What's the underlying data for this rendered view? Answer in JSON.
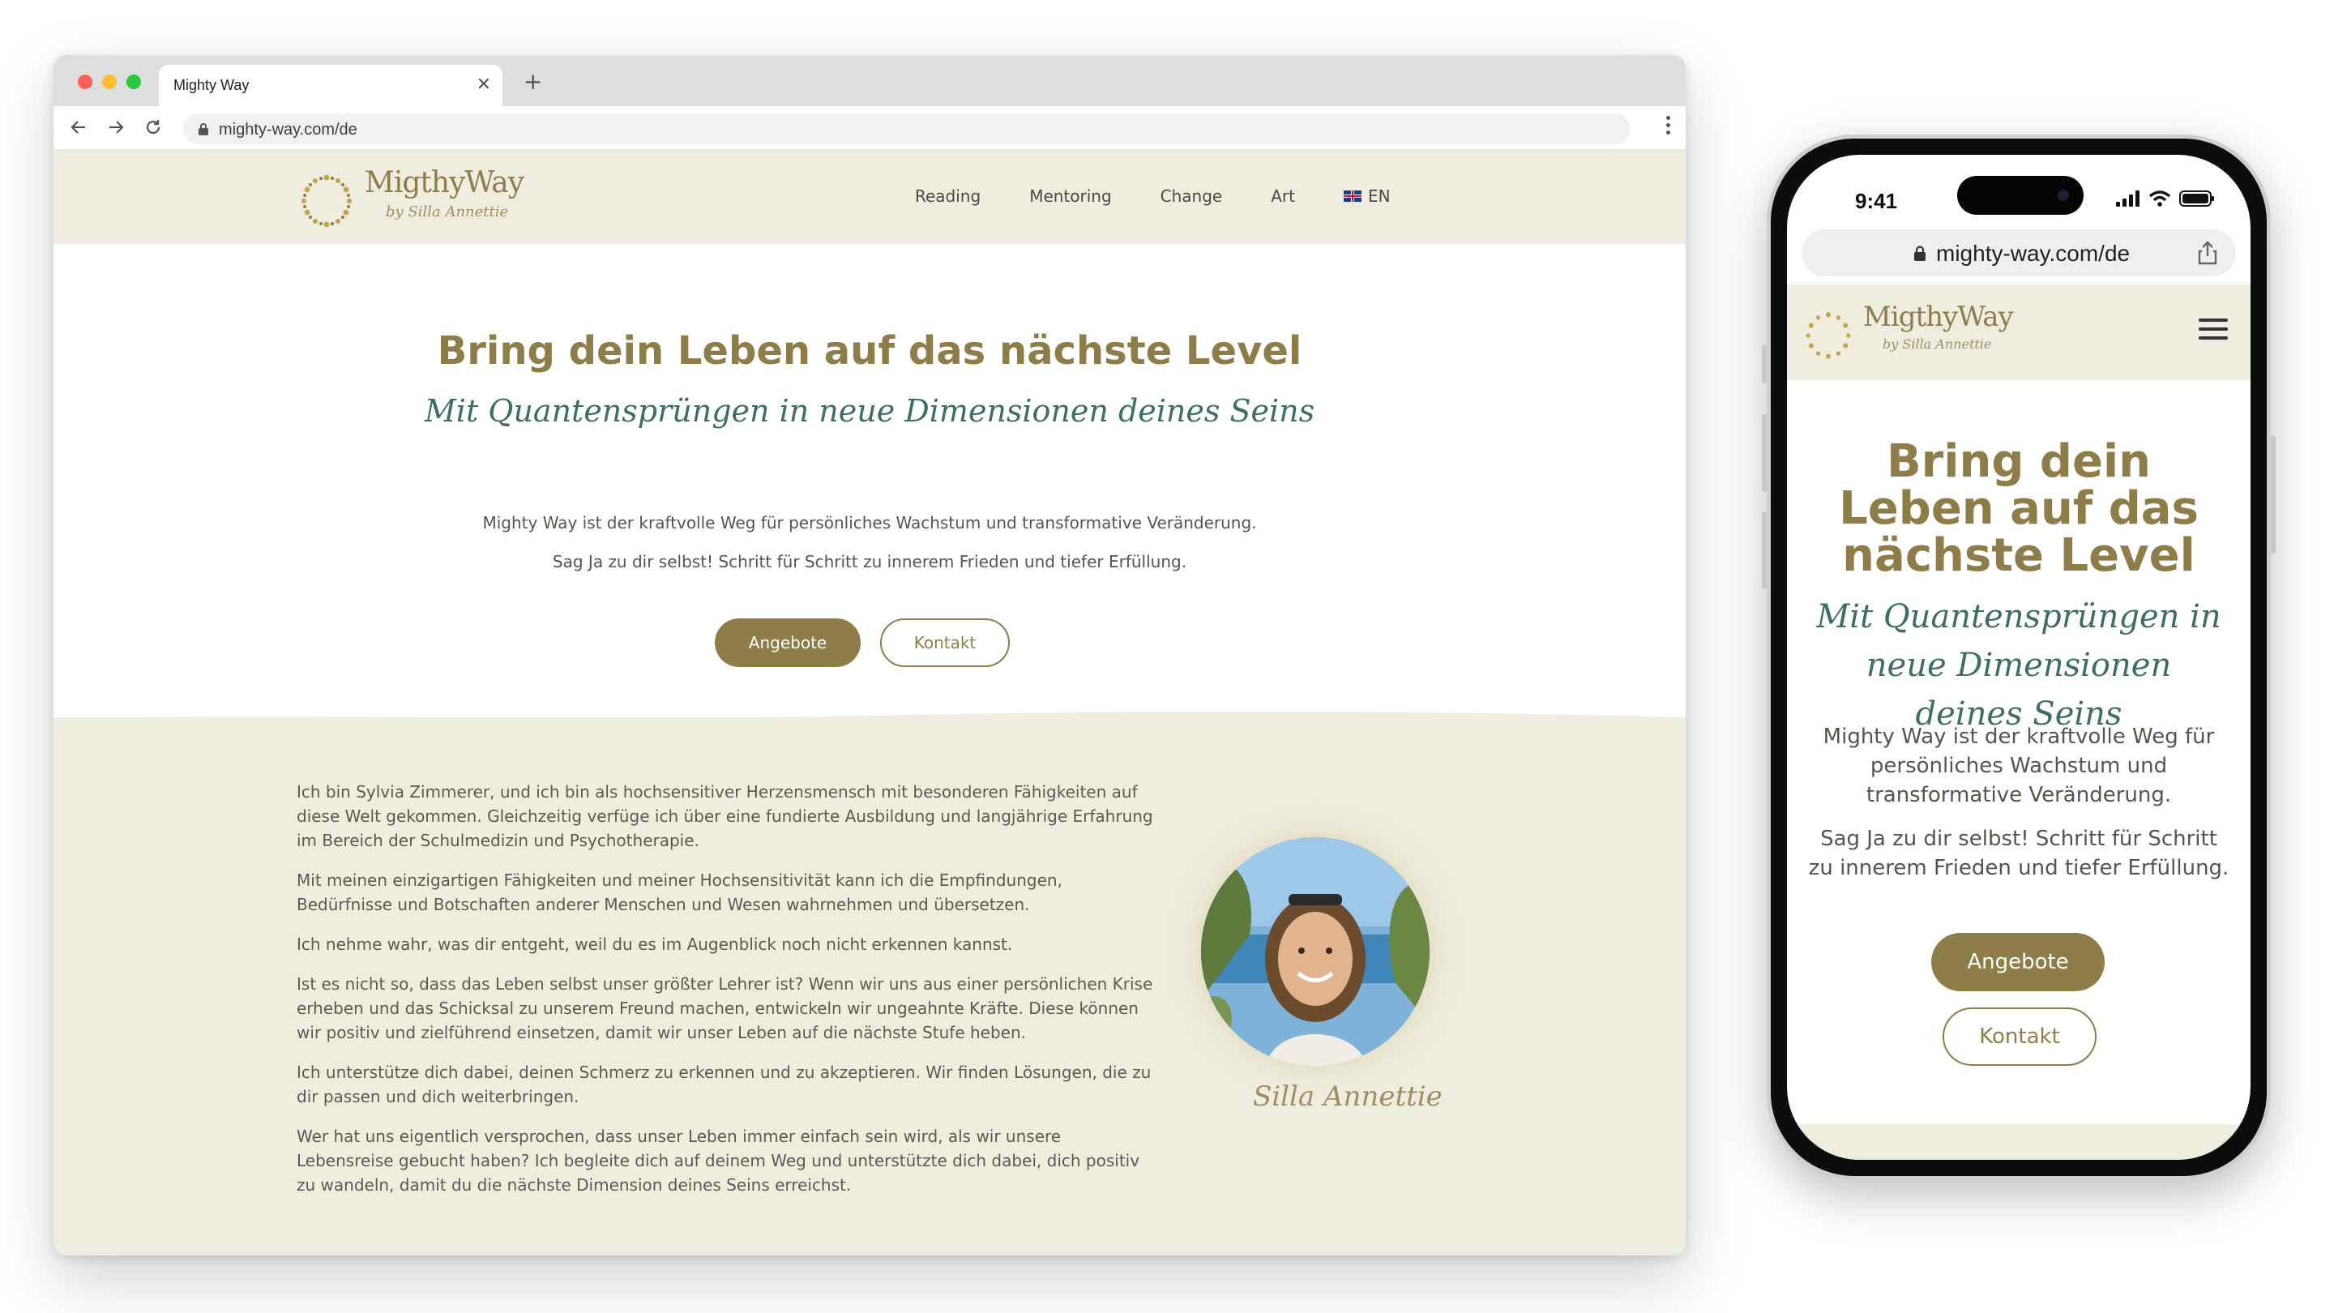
{
  "browser": {
    "tab_title": "Mighty Way",
    "url": "mighty-way.com/de"
  },
  "site": {
    "logo_word": "MigthyWay",
    "logo_sign": "by Silla Annettie",
    "menu": [
      {
        "label": "Reading"
      },
      {
        "label": "Mentoring"
      },
      {
        "label": "Change"
      },
      {
        "label": "Art"
      },
      {
        "label": "EN"
      }
    ],
    "hero": {
      "title": "Bring dein Leben auf das nächste Level",
      "script": "Mit Quantensprüngen in neue Dimensionen deines Seins",
      "p1": "Mighty Way ist der kraftvolle Weg für persönliches Wachstum und transformative Veränderung.",
      "p2": "Sag Ja zu dir selbst! Schritt für Schritt zu innerem Frieden und tiefer Erfüllung.",
      "btn_primary": "Angebote",
      "btn_secondary": "Kontakt"
    },
    "about": {
      "paragraphs": [
        "Ich bin Sylvia Zimmerer, und ich bin als hochsensitiver Herzensmensch mit besonderen Fähigkeiten auf diese Welt gekommen. Gleichzeitig verfüge ich über eine fundierte Ausbildung und langjährige Erfahrung im Bereich der Schulmedizin und Psychotherapie.",
        "Mit meinen einzigartigen Fähigkeiten und meiner Hochsensitivität kann ich die Empfindungen, Bedürfnisse und Botschaften anderer Menschen und Wesen wahrnehmen und übersetzen.",
        "Ich nehme wahr, was dir entgeht, weil du es im Augenblick noch nicht erkennen kannst.",
        "Ist es nicht so, dass das Leben selbst unser größter Lehrer ist? Wenn wir uns aus einer persönlichen Krise erheben und das Schicksal zu unserem Freund machen, entwickeln wir ungeahnte Kräfte. Diese können wir positiv und zielführend einsetzen, damit wir unser Leben auf die nächste Stufe heben.",
        "Ich unterstütze dich dabei, deinen Schmerz zu erkennen und zu akzeptieren. Wir finden Lösungen, die zu dir passen und dich weiterbringen.",
        "Wer hat uns eigentlich versprochen, dass unser Leben immer einfach sein wird, als wir unsere Lebensreise gebucht haben? Ich begleite dich auf deinem Weg und unterstützte dich dabei, dich positiv zu wandeln, damit du die nächste Dimension deines Seins erreichst."
      ],
      "signature": "Silla Annettie"
    }
  },
  "phone": {
    "time": "9:41",
    "url": "mighty-way.com/de",
    "title": "Bring dein Leben auf das nächste Level",
    "script": "Mit Quantensprüngen in neue Dimensionen deines Seins",
    "p1": "Mighty Way ist der kraftvolle Weg für persönliches Wachstum und transformative Veränderung.",
    "p2": "Sag Ja zu dir selbst! Schritt für Schritt zu innerem Frieden und tiefer Erfüllung.",
    "btn_primary": "Angebote",
    "btn_secondary": "Kontakt"
  },
  "colors": {
    "brand_gold": "#8e7d48",
    "script_teal": "#3d6e66",
    "cream": "#efede0"
  }
}
